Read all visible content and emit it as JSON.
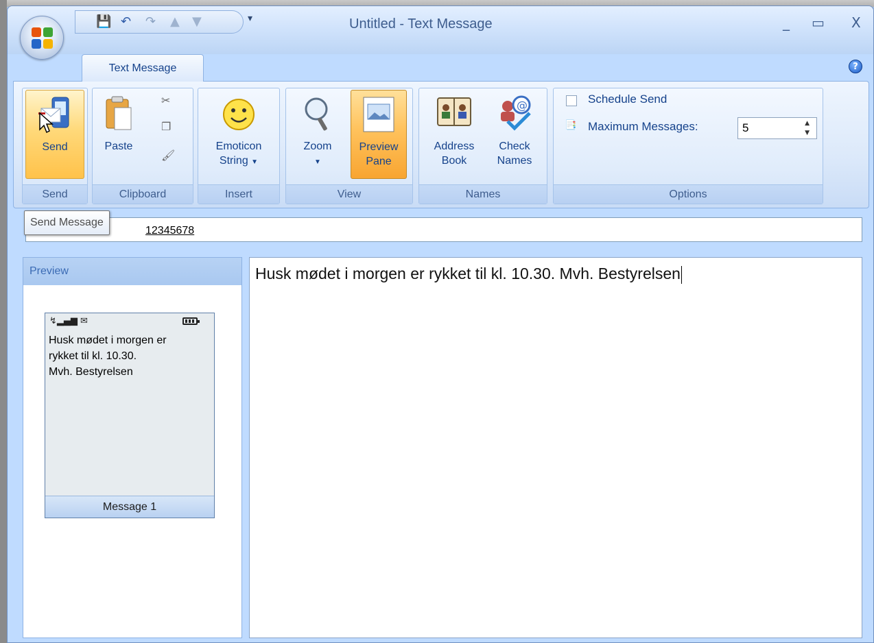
{
  "window": {
    "title": "Untitled - Text Message",
    "minimize": "_",
    "maximize": "▭",
    "close": "X"
  },
  "tabs": [
    {
      "label": "Text Message"
    }
  ],
  "ribbon": {
    "send": {
      "label": "Send",
      "group": "Send",
      "tooltip": "Send Message"
    },
    "clipboard": {
      "paste": "Paste",
      "group": "Clipboard"
    },
    "insert": {
      "emoticon_line1": "Emoticon",
      "emoticon_line2": "String",
      "group": "Insert"
    },
    "view": {
      "zoom": "Zoom",
      "preview_line1": "Preview",
      "preview_line2": "Pane",
      "group": "View"
    },
    "names": {
      "address_line1": "Address",
      "address_line2": "Book",
      "check_line1": "Check",
      "check_line2": "Names",
      "group": "Names"
    },
    "options": {
      "schedule_send": "Schedule Send",
      "max_messages_label": "Maximum Messages:",
      "max_messages_value": "5",
      "group": "Options"
    }
  },
  "to": {
    "value": "12345678"
  },
  "preview": {
    "title": "Preview",
    "phone_text": "Husk mødet i morgen er\nrykket til kl. 10.30.\nMvh. Bestyrelsen",
    "message_label": "Message 1"
  },
  "message": {
    "body": "Husk mødet i morgen er rykket til kl. 10.30. Mvh. Bestyrelsen"
  },
  "colors": {
    "ribbon_bg": "#dce9fa",
    "accent_orange": "#ffc24a",
    "title_text": "#3e5d8e"
  }
}
